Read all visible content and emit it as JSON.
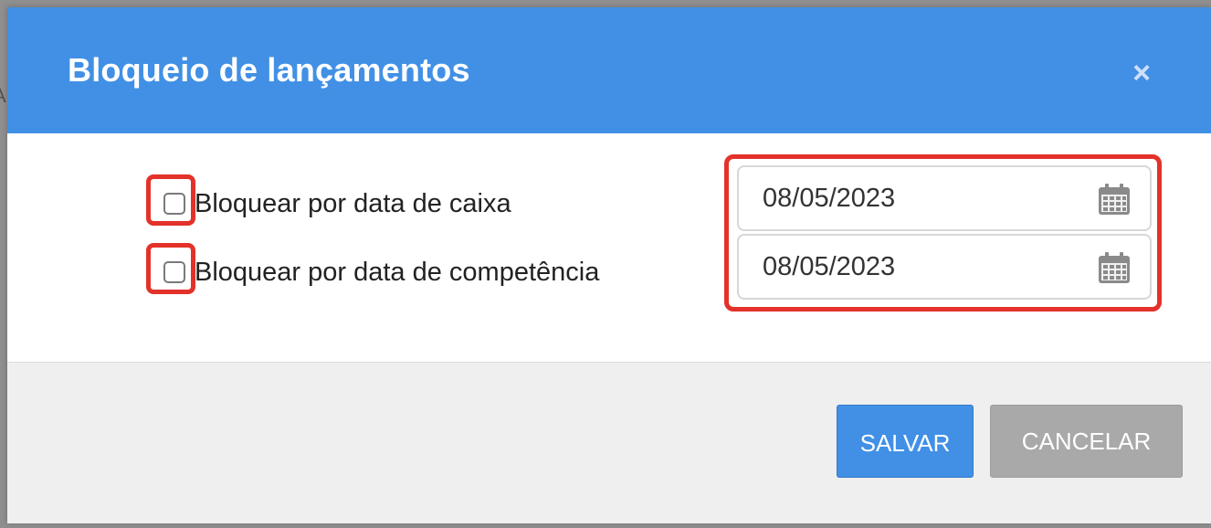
{
  "modal": {
    "title": "Bloqueio de lançamentos",
    "close_label": "×"
  },
  "options": [
    {
      "label": "Bloquear por data de caixa",
      "checked": false,
      "date_value": "08/05/2023",
      "date_icon": "calendar-icon"
    },
    {
      "label": "Bloquear por data de competência",
      "checked": false,
      "date_value": "08/05/2023",
      "date_icon": "calendar-icon"
    }
  ],
  "footer": {
    "save_label": "SALVAR",
    "cancel_label": "CANCELAR"
  },
  "colors": {
    "header": "#4190e5",
    "highlight": "#e3322a",
    "save_button": "#4190e5",
    "cancel_button": "#a9a9a9"
  }
}
